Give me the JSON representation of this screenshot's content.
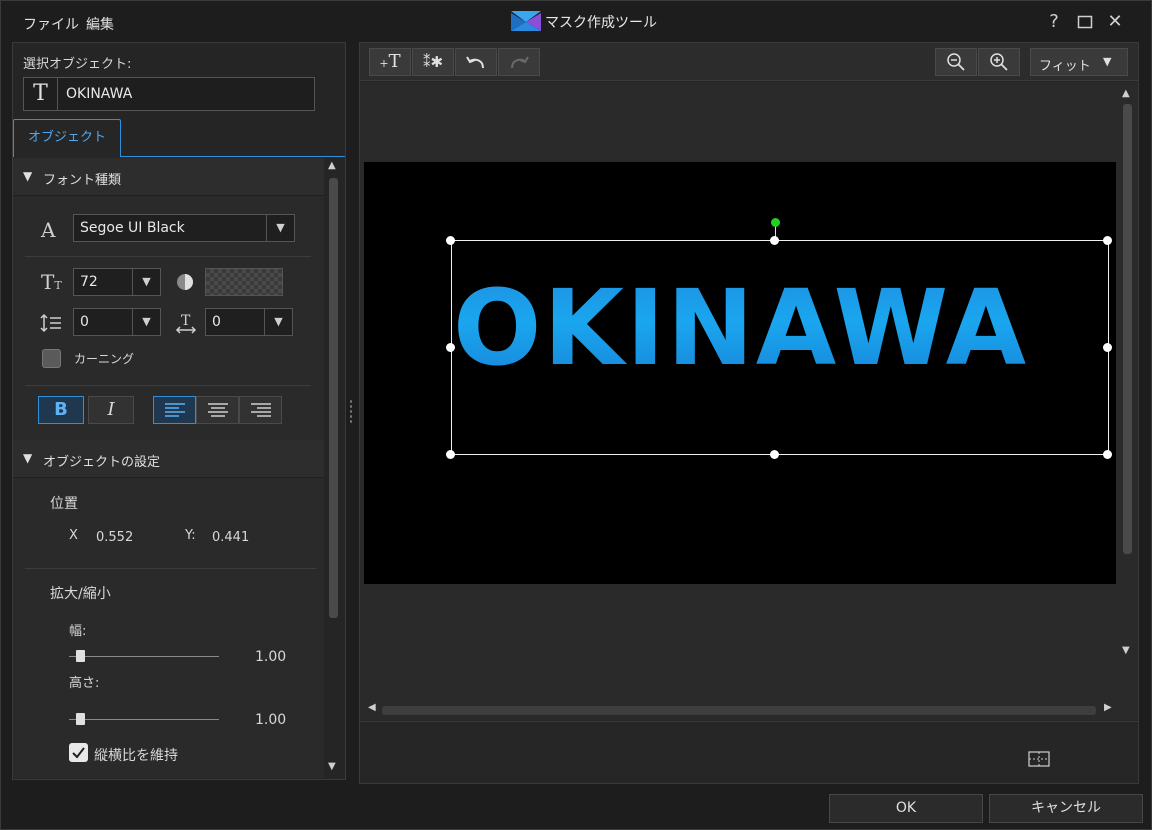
{
  "menu": {
    "file": "ファイル",
    "edit": "編集"
  },
  "window": {
    "title": "マスク作成ツール",
    "help": "?",
    "maximize": "☐",
    "close": "✕"
  },
  "left": {
    "selected_label": "選択オブジェクト:",
    "selected_value": "OKINAWA",
    "tab_object": "オブジェクト",
    "font_section": "フォント種類",
    "font_name": "Segoe UI Black",
    "font_size": "72",
    "line_spacing": "0",
    "char_spacing": "0",
    "kerning_label": "カーニング",
    "bold": "B",
    "italic": "I",
    "object_section": "オブジェクトの設定",
    "position_label": "位置",
    "x_label": "X",
    "x_value": "0.552",
    "y_label": "Y:",
    "y_value": "0.441",
    "scale_label": "拡大/縮小",
    "width_label": "幅:",
    "width_value": "1.00",
    "height_label": "高さ:",
    "height_value": "1.00",
    "keep_ratio_label": "縦横比を維持",
    "keep_ratio_checked": true,
    "kerning_checked": false
  },
  "toolbar": {
    "zoom_select": "フィット"
  },
  "preview": {
    "text": "OKINAWA"
  },
  "footer": {
    "ok": "OK",
    "cancel": "キャンセル"
  },
  "colors": {
    "accent": "#2f8fd8",
    "text_fill": "#1b8fe0",
    "rotate_handle": "#22d022"
  }
}
